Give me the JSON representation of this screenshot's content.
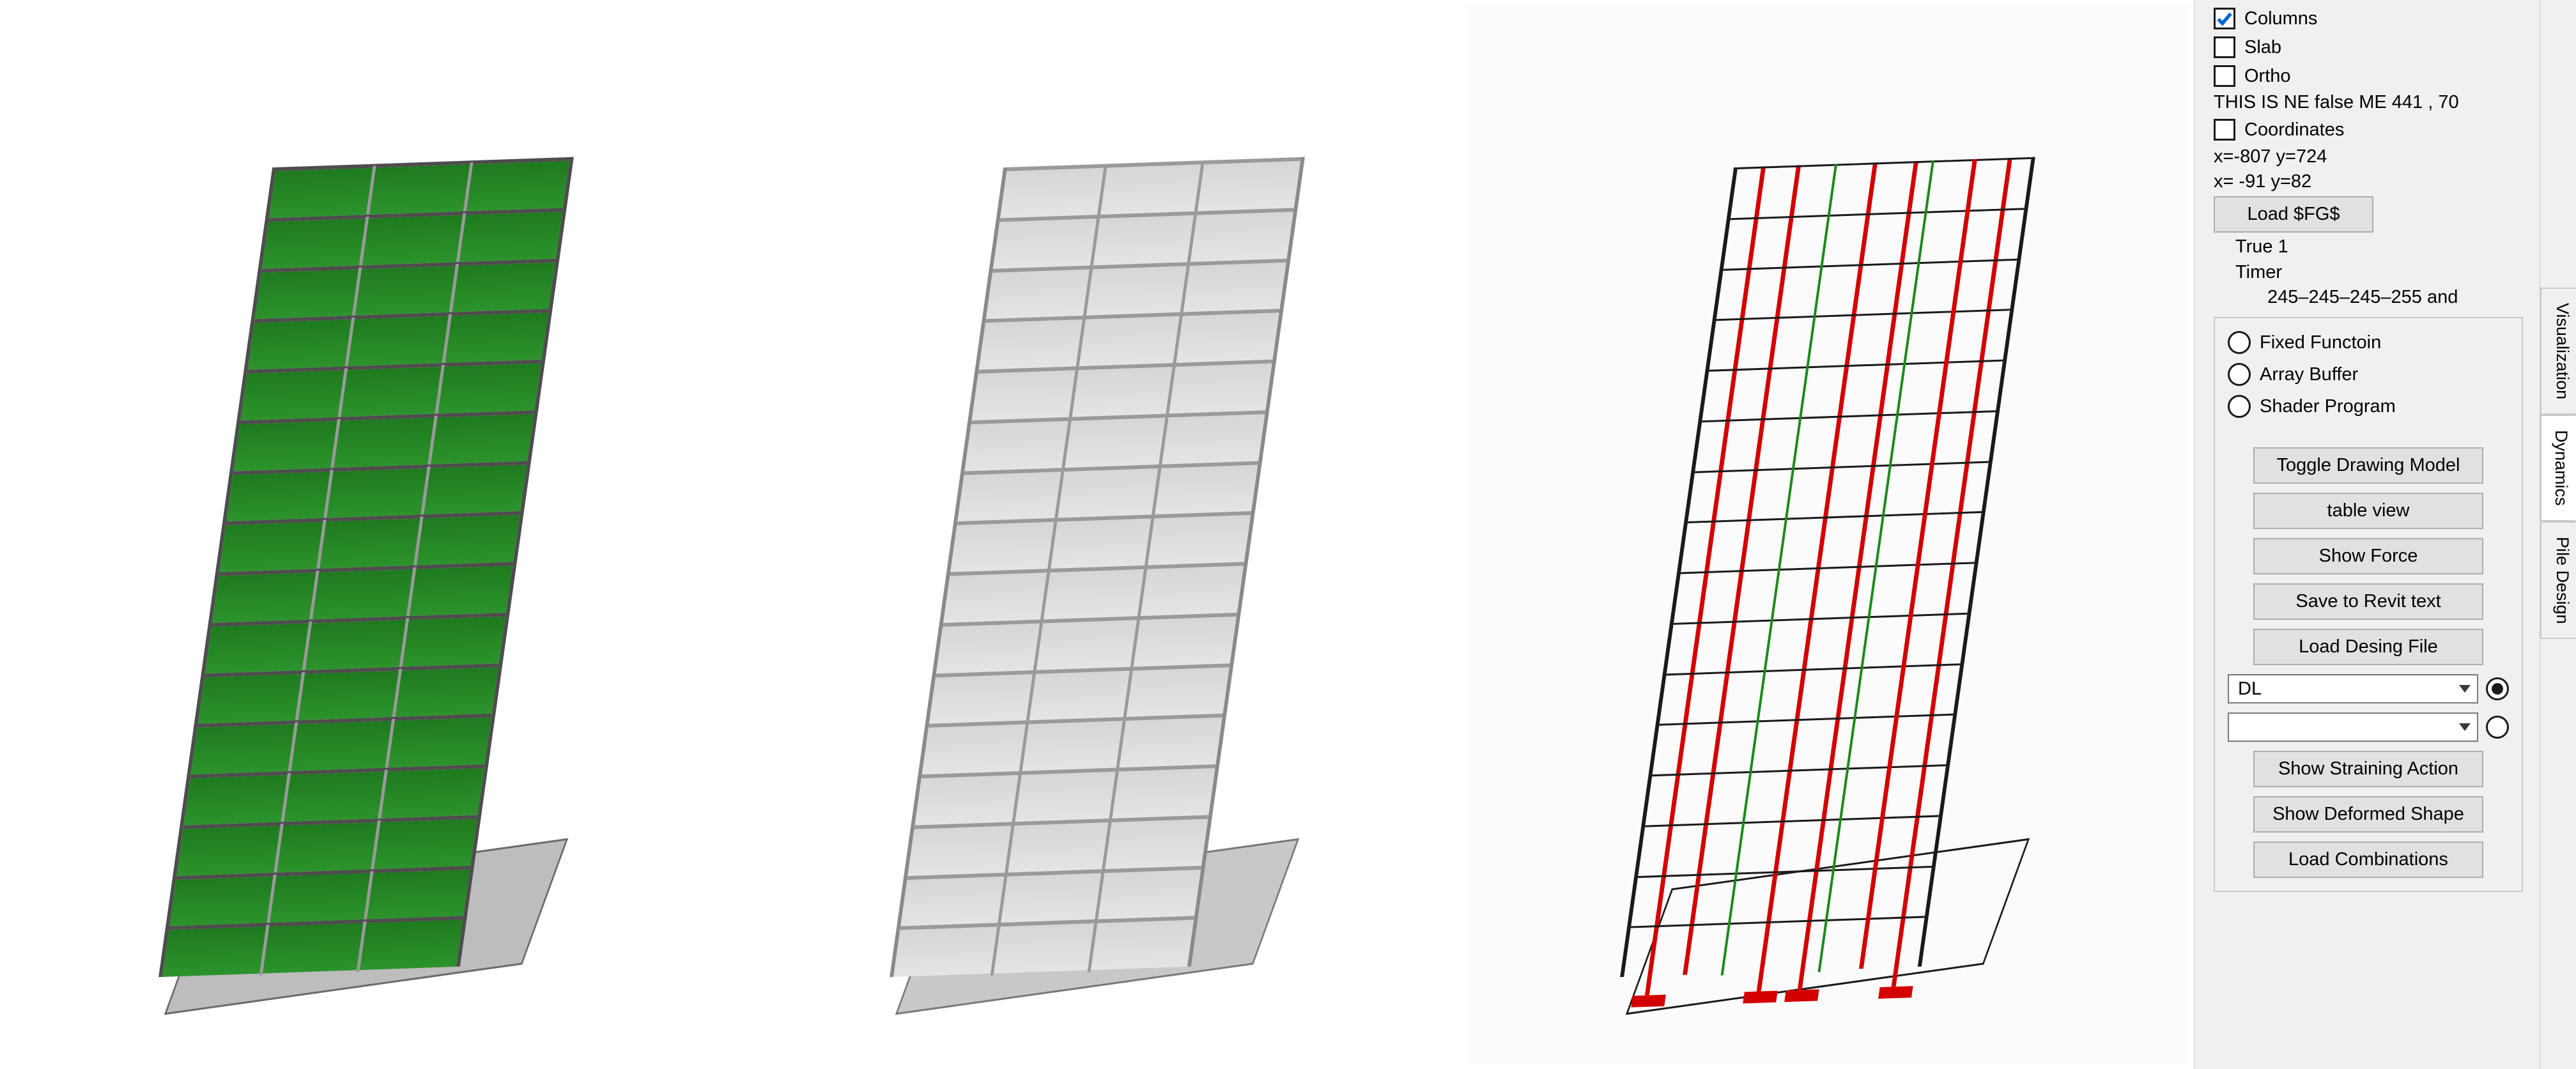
{
  "checkboxes": {
    "columns": {
      "label": "Columns",
      "checked": true
    },
    "slab": {
      "label": "Slab",
      "checked": false
    },
    "ortho": {
      "label": "Ortho",
      "checked": false
    },
    "coords": {
      "label": "Coordinates",
      "checked": false
    }
  },
  "status": {
    "ne_line": "THIS IS NE false   ME  441 , 70",
    "coord1": "x=-807 y=724",
    "coord2": "x= -91 y=82",
    "true_line": "True 1",
    "timer_label": "Timer",
    "timer_values": "245–245–245–255 and"
  },
  "buttons": {
    "load_fg": "Load $FG$",
    "toggle_model": "Toggle Drawing Model",
    "table_view": "table view",
    "show_force": "Show Force",
    "save_revit": "Save to Revit text",
    "load_design": "Load Desing File",
    "show_straining": "Show Straining Action",
    "show_deformed": "Show Deformed Shape",
    "load_combos": "Load Combinations"
  },
  "radios": {
    "fixed": "Fixed Functoin",
    "array": "Array Buffer",
    "shader": "Shader Program"
  },
  "selects": {
    "primary_value": "DL",
    "secondary_value": ""
  },
  "tabs": {
    "visualization": "Visualization",
    "dynamics": "Dynamics",
    "pile": "Pile Design"
  },
  "viewports": {
    "left": "shaded-green-building",
    "center": "shaded-gray-building",
    "right": "wireframe-analysis-building"
  }
}
